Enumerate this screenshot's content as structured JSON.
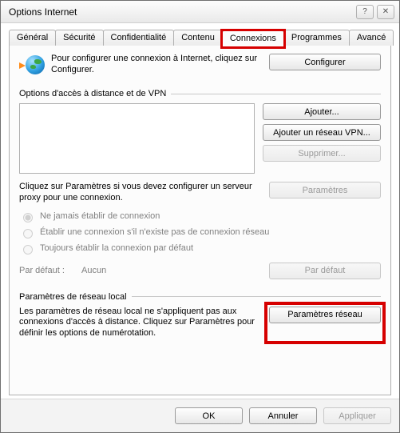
{
  "window": {
    "title": "Options Internet",
    "help_label": "?",
    "close_label": "✕"
  },
  "tabs": [
    {
      "label": "Général"
    },
    {
      "label": "Sécurité"
    },
    {
      "label": "Confidentialité"
    },
    {
      "label": "Contenu"
    },
    {
      "label": "Connexions"
    },
    {
      "label": "Programmes"
    },
    {
      "label": "Avancé"
    }
  ],
  "intro": {
    "text": "Pour configurer une connexion à Internet, cliquez sur Configurer.",
    "configure_btn": "Configurer"
  },
  "dialup": {
    "header": "Options d'accès à distance et de VPN",
    "add_btn": "Ajouter...",
    "add_vpn_btn": "Ajouter un réseau VPN...",
    "remove_btn": "Supprimer...",
    "proxy_text": "Cliquez sur Paramètres si vous devez configurer un serveur proxy pour une connexion.",
    "settings_btn": "Paramètres",
    "radio_never": "Ne jamais établir de connexion",
    "radio_dial_none": "Établir une connexion s'il n'existe pas de connexion réseau",
    "radio_always": "Toujours établir la connexion par défaut",
    "default_label": "Par défaut :",
    "default_value": "Aucun",
    "default_btn": "Par défaut"
  },
  "lan": {
    "header": "Paramètres de réseau local",
    "text": "Les paramètres de réseau local ne s'appliquent pas aux connexions d'accès à distance. Cliquez sur Paramètres pour définir les options de numérotation.",
    "settings_btn": "Paramètres réseau"
  },
  "footer": {
    "ok": "OK",
    "cancel": "Annuler",
    "apply": "Appliquer"
  }
}
